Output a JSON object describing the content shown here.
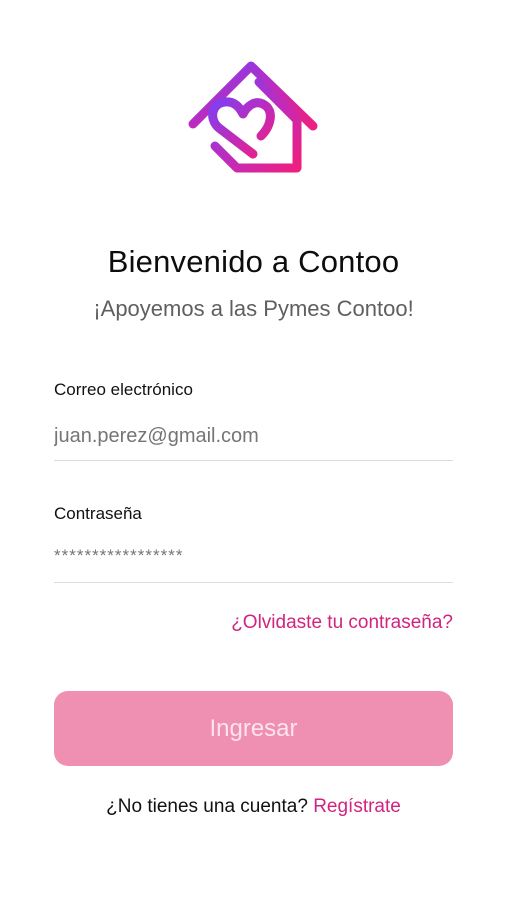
{
  "app": {
    "logo_icon": "house-heart-icon",
    "brand_colors": {
      "gradient_start": "#8b3ff0",
      "gradient_end": "#e8208a",
      "accent": "#d2237f",
      "button": "#ef8fb1"
    }
  },
  "header": {
    "title": "Bienvenido a Contoo",
    "subtitle": "¡Apoyemos a las Pymes Contoo!"
  },
  "form": {
    "email": {
      "label": "Correo electrónico",
      "placeholder": "juan.perez@gmail.com"
    },
    "password": {
      "label": "Contraseña",
      "placeholder": "*****************"
    },
    "forgot_label": "¿Olvidaste tu contraseña?",
    "submit_label": "Ingresar"
  },
  "footer": {
    "prompt": "¿No tienes una cuenta?",
    "signup_label": "Regístrate"
  }
}
